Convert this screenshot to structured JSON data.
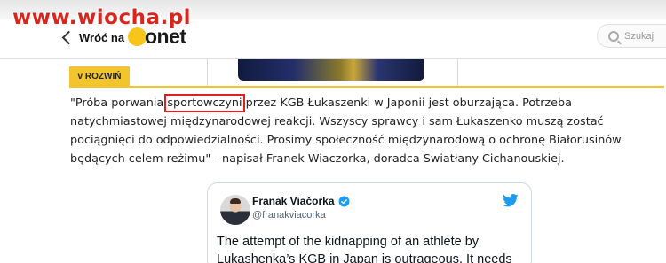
{
  "watermark": "www.wiocha.pl",
  "header": {
    "back_label": "Wróć na",
    "logo_text": "onet",
    "search_placeholder": "Szukaj"
  },
  "rozwin_label": "ROZWIŃ",
  "quote": {
    "before": "\"Próba porwania ",
    "highlight": "sportowczyni",
    "after": " przez KGB Łukaszenki w Japonii jest oburzająca. Potrzeba natychmiastowej międzynarodowej reakcji. Wszyscy sprawcy i sam Łukaszenko muszą zostać pociągnięci do odpowiedzialności. Prosimy społeczność międzynarodową o ochronę Białorusinów będących celem reżimu\" - napisał Franek Wiaczorka, doradca Swiatłany Cichanouskiej."
  },
  "tweet": {
    "author_name": "Franak Viačorka",
    "handle": "@franakviacorka",
    "text": "The attempt of the kidnapping of an athlete by Lukashenka’s KGB in Japan is outrageous. It needs"
  },
  "colors": {
    "watermark": "#d9251c",
    "accent_yellow": "#f3c52d",
    "highlight_box": "#e0201f",
    "twitter_blue": "#1d9bf0"
  },
  "icons": [
    "back-chevron-icon",
    "search-icon",
    "verified-icon",
    "twitter-bird-icon"
  ]
}
